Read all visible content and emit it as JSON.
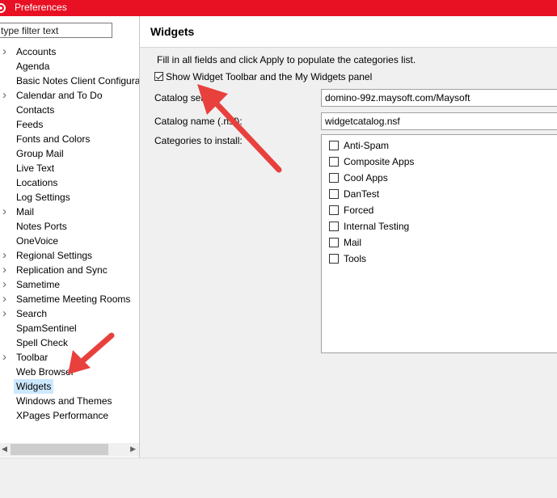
{
  "window": {
    "title": "Preferences"
  },
  "filter": {
    "placeholder": "type filter text"
  },
  "tree": {
    "items": [
      {
        "label": "Accounts",
        "expandable": true
      },
      {
        "label": "Agenda",
        "expandable": false
      },
      {
        "label": "Basic Notes Client Configura",
        "expandable": false
      },
      {
        "label": "Calendar and To Do",
        "expandable": true
      },
      {
        "label": "Contacts",
        "expandable": false
      },
      {
        "label": "Feeds",
        "expandable": false
      },
      {
        "label": "Fonts and Colors",
        "expandable": false
      },
      {
        "label": "Group Mail",
        "expandable": false
      },
      {
        "label": "Live Text",
        "expandable": false
      },
      {
        "label": "Locations",
        "expandable": false
      },
      {
        "label": "Log Settings",
        "expandable": false
      },
      {
        "label": "Mail",
        "expandable": true
      },
      {
        "label": "Notes Ports",
        "expandable": false
      },
      {
        "label": "OneVoice",
        "expandable": false
      },
      {
        "label": "Regional Settings",
        "expandable": true
      },
      {
        "label": "Replication and Sync",
        "expandable": true
      },
      {
        "label": "Sametime",
        "expandable": true
      },
      {
        "label": "Sametime Meeting Rooms",
        "expandable": true
      },
      {
        "label": "Search",
        "expandable": true
      },
      {
        "label": "SpamSentinel",
        "expandable": false
      },
      {
        "label": "Spell Check",
        "expandable": false
      },
      {
        "label": "Toolbar",
        "expandable": true
      },
      {
        "label": "Web Browser",
        "expandable": false
      },
      {
        "label": "Widgets",
        "expandable": false,
        "selected": true
      },
      {
        "label": "Windows and Themes",
        "expandable": false
      },
      {
        "label": "XPages Performance",
        "expandable": false
      }
    ]
  },
  "page": {
    "heading": "Widgets",
    "instructions": "Fill in all fields and click Apply to populate the categories list.",
    "show_toolbar_label": "Show Widget Toolbar and the My Widgets panel",
    "show_toolbar_checked": true,
    "catalog_server_label": "Catalog server:",
    "catalog_server_value": "domino-99z.maysoft.com/Maysoft",
    "catalog_name_label": "Catalog name (.nsf):",
    "catalog_name_value": "widgetcatalog.nsf",
    "categories_label": "Categories to install:",
    "categories": [
      {
        "label": "Anti-Spam",
        "checked": false
      },
      {
        "label": "Composite Apps",
        "checked": false
      },
      {
        "label": "Cool Apps",
        "checked": false
      },
      {
        "label": "DanTest",
        "checked": false
      },
      {
        "label": "Forced",
        "checked": false
      },
      {
        "label": "Internal Testing",
        "checked": false
      },
      {
        "label": "Mail",
        "checked": false
      },
      {
        "label": "Tools",
        "checked": false
      }
    ]
  },
  "colors": {
    "titlebar": "#e81123",
    "selection": "#cce8ff",
    "annotation_arrow": "#e8413d"
  }
}
